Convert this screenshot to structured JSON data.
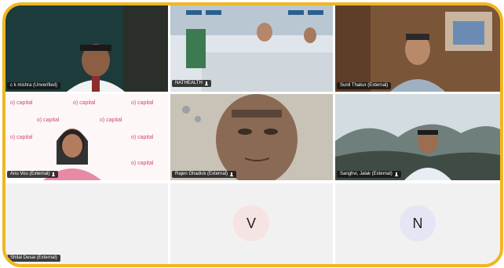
{
  "participants": [
    {
      "name": "c k mishra (Unverified)",
      "muted": false,
      "avatar_letter": ""
    },
    {
      "name": "NATHEALTH",
      "muted": true,
      "avatar_letter": ""
    },
    {
      "name": "Sunil Thakur (External)",
      "muted": false,
      "avatar_letter": ""
    },
    {
      "name": "Anu Vou (External)",
      "muted": true,
      "avatar_letter": ""
    },
    {
      "name": "Rajen Ghadick (External)",
      "muted": true,
      "avatar_letter": ""
    },
    {
      "name": "Sanghvi, Jalak (External)",
      "muted": true,
      "avatar_letter": ""
    },
    {
      "name": "Shital Desai (External)",
      "muted": false,
      "avatar_letter": ""
    },
    {
      "name": "",
      "muted": false,
      "avatar_letter": "V"
    },
    {
      "name": "",
      "muted": false,
      "avatar_letter": "N"
    }
  ],
  "brand_logo_text": "o) capital",
  "colors": {
    "frame_border": "#f0b621",
    "avatar_v": "#f6e3e3",
    "avatar_n": "#e5e6f4"
  },
  "icons": {
    "mic": "microphone-icon",
    "mic_off": "microphone-off-icon"
  }
}
